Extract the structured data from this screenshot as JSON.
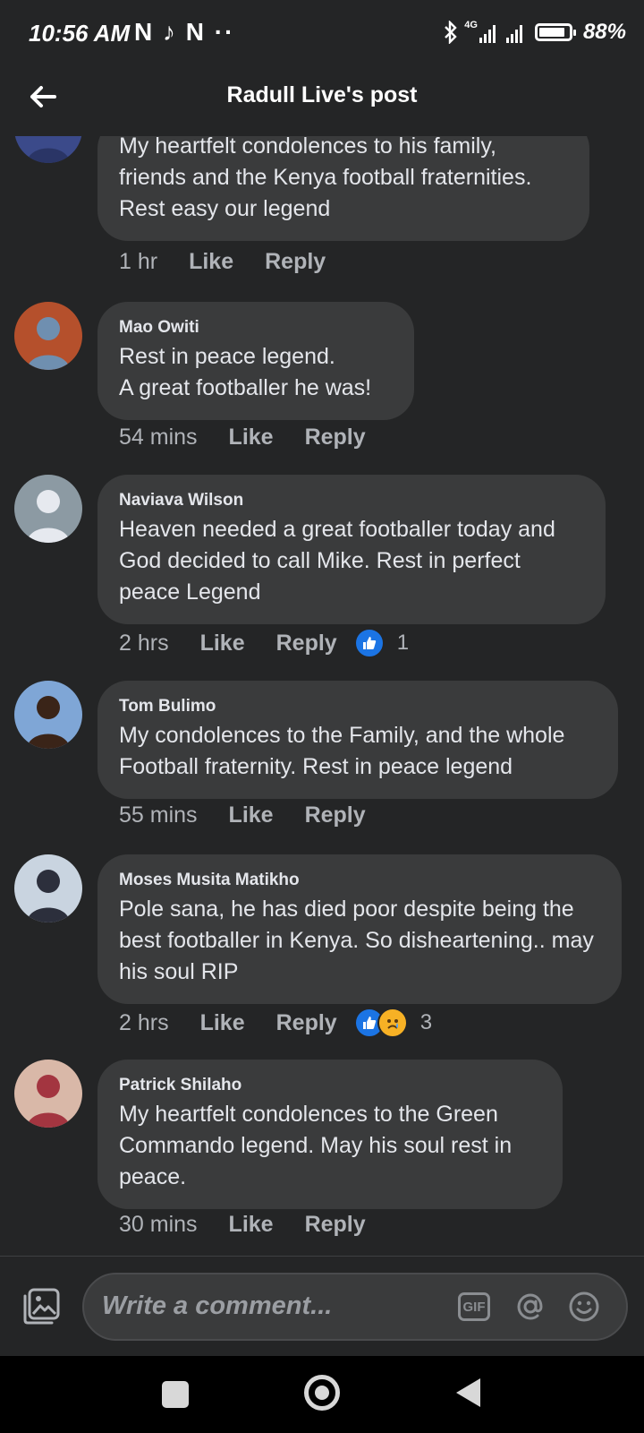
{
  "status_bar": {
    "time": "10:56 AM",
    "notif_icons": "N ♪ N ··",
    "network": "4G",
    "battery": "88%",
    "battery_level": 0.88
  },
  "header": {
    "title": "Radull Live's post",
    "back_icon": "arrow-left-icon"
  },
  "comments": [
    {
      "author": "",
      "text": "My heartfelt condolences to his family, friends and the Kenya football fraternities. Rest easy our legend",
      "time": "1 hr",
      "like": "Like",
      "reply": "Reply",
      "reactions": null,
      "avatar_colors": [
        "#3b4a8a",
        "#2a3566"
      ]
    },
    {
      "author": "Mao Owiti",
      "text": "Rest in peace legend.\nA great footballer he was!",
      "time": "54 mins",
      "like": "Like",
      "reply": "Reply",
      "reactions": null,
      "avatar_colors": [
        "#b5502c",
        "#6f8fb0"
      ]
    },
    {
      "author": "Naviava Wilson",
      "text": "Heaven needed a great footballer today and God decided to call Mike. Rest in perfect peace Legend",
      "time": "2 hrs",
      "like": "Like",
      "reply": "Reply",
      "reactions": {
        "types": [
          "like"
        ],
        "count": "1"
      },
      "avatar_colors": [
        "#8c9aa3",
        "#e6e9ef"
      ]
    },
    {
      "author": "Tom Bulimo",
      "text": "My condolences to the Family, and the whole Football fraternity. Rest in peace legend",
      "time": "55 mins",
      "like": "Like",
      "reply": "Reply",
      "reactions": null,
      "avatar_colors": [
        "#7fa6d6",
        "#3a2418"
      ]
    },
    {
      "author": "Moses Musita Matikho",
      "text": "Pole sana, he has died poor despite being the best footballer in Kenya. So disheartening.. may his soul RIP",
      "time": "2 hrs",
      "like": "Like",
      "reply": "Reply",
      "reactions": {
        "types": [
          "like",
          "sad"
        ],
        "count": "3"
      },
      "avatar_colors": [
        "#c9d4e0",
        "#2c2f3c"
      ]
    },
    {
      "author": "Patrick Shilaho",
      "text": "My heartfelt condolences to the Green Commando legend. May his soul rest in peace.",
      "time": "30 mins",
      "like": "Like",
      "reply": "Reply",
      "reactions": null,
      "avatar_colors": [
        "#d9b8a8",
        "#a33540"
      ]
    }
  ],
  "composer": {
    "placeholder": "Write a comment...",
    "gif_label": "GIF",
    "photo_icon": "photo-gallery-icon",
    "mention_icon": "at-sign-icon",
    "emoji_icon": "smiley-icon"
  },
  "nav": {
    "recents_icon": "square-icon",
    "home_icon": "circle-icon",
    "back_icon": "triangle-back-icon"
  }
}
